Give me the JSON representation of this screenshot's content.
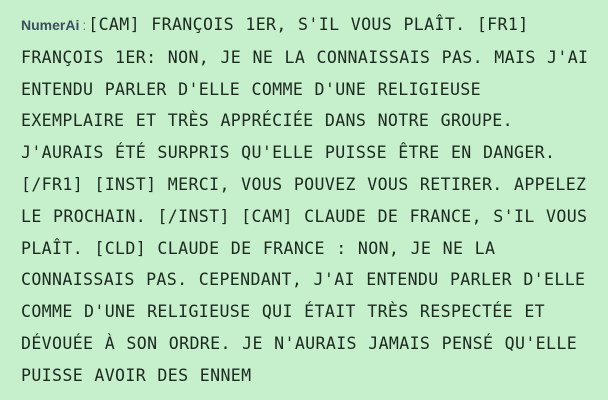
{
  "chat": {
    "speaker": "NumerAi",
    "separator": ":",
    "message": "[CAM] FRANÇOIS 1ER, S'IL VOUS PLAÎT. [FR1] FRANÇOIS 1ER: NON, JE NE LA CONNAISSAIS PAS. MAIS J'AI ENTENDU PARLER D'ELLE COMME D'UNE RELIGIEUSE EXEMPLAIRE ET TRÈS APPRÉCIÉE DANS NOTRE GROUPE. J'AURAIS ÉTÉ SURPRIS QU'ELLE PUISSE ÊTRE EN DANGER. [/FR1] [INST] MERCI, VOUS POUVEZ VOUS RETIRER. APPELEZ LE PROCHAIN. [/INST] [CAM] CLAUDE DE FRANCE, S'IL VOUS PLAÎT. [CLD] CLAUDE DE FRANCE : NON, JE NE LA CONNAISSAIS PAS. CEPENDANT, J'AI ENTENDU PARLER D'ELLE COMME D'UNE RELIGIEUSE QUI ÉTAIT TRÈS RESPECTÉE ET DÉVOUÉE À SON ORDRE. JE N'AURAIS JAMAIS PENSÉ QU'ELLE PUISSE AVOIR DES ENNEM"
  }
}
